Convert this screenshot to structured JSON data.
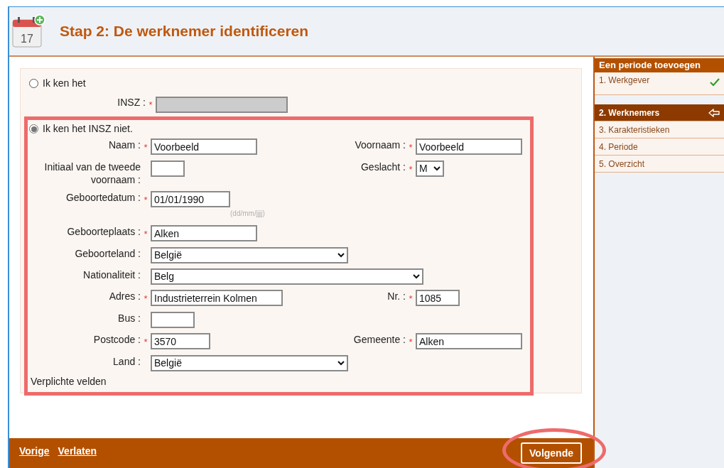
{
  "header": {
    "calendar_day": "17",
    "title": "Stap 2: De werknemer identificeren"
  },
  "form": {
    "known_option": {
      "label": "Ik ken het",
      "selected": false
    },
    "insz_field": {
      "label": "INSZ :",
      "required_mark": "*",
      "disabled": true
    },
    "unknown_option": {
      "label": "Ik ken het INSZ niet.",
      "selected": true
    },
    "rows": [
      {
        "left": {
          "label": "Naam :",
          "required_mark": "*",
          "kind": "text",
          "value": "Voorbeeld"
        },
        "right": {
          "label": "Voornaam :",
          "required_mark": "*",
          "kind": "text",
          "value": "Voorbeeld"
        }
      },
      {
        "left": {
          "label": "Initiaal van de tweede voornaam :",
          "kind": "text"
        },
        "right": {
          "label": "Geslacht :",
          "required_mark": "*",
          "kind": "select",
          "value": "M"
        }
      },
      {
        "left": {
          "label": "Geboortedatum :",
          "required_mark": "*",
          "kind": "text",
          "value": "01/01/1990",
          "hint": "(dd/mm/jjjj)"
        }
      },
      {
        "left": {
          "label": "Geboorteplaats :",
          "required_mark": "*",
          "kind": "text",
          "value": "Alken"
        }
      },
      {
        "left": {
          "label": "Geboorteland :",
          "kind": "select",
          "value": "België"
        }
      },
      {
        "left": {
          "label": "Nationaliteit :",
          "kind": "select",
          "value": "Belg"
        }
      },
      {
        "left": {
          "label": "Adres :",
          "required_mark": "*",
          "kind": "text",
          "value": "Industrieterrein Kolmen"
        },
        "right": {
          "label": "Nr. :",
          "required_mark": "*",
          "kind": "text",
          "value": "1085"
        }
      },
      {
        "left": {
          "label": "Bus :",
          "kind": "text"
        }
      },
      {
        "left": {
          "label": "Postcode :",
          "required_mark": "*",
          "kind": "text",
          "value": "3570"
        },
        "right": {
          "label": "Gemeente :",
          "required_mark": "*",
          "kind": "text",
          "value": "Alken"
        }
      },
      {
        "left": {
          "label": "Land :",
          "kind": "select",
          "value": "België"
        }
      }
    ],
    "footnote": "Verplichte velden"
  },
  "sidebar": {
    "title": "Een periode toevoegen",
    "steps": [
      {
        "label": "1. Werkgever",
        "selected": false,
        "done": true
      },
      {
        "label": "2. Werknemers",
        "selected": true,
        "done": false
      },
      {
        "label": "3. Karakteristieken",
        "selected": false,
        "done": false
      },
      {
        "label": "4. Periode",
        "selected": false,
        "done": false
      },
      {
        "label": "5. Overzicht",
        "selected": false,
        "done": false
      }
    ]
  },
  "footer": {
    "links": [
      "Vorige",
      "Verlaten"
    ],
    "next_button": "Volgende"
  }
}
